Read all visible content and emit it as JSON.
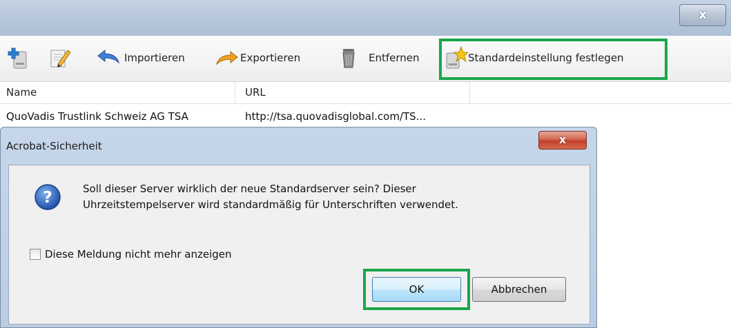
{
  "window": {
    "close_glyph": "x"
  },
  "toolbar": {
    "items": [
      {
        "label": "",
        "icon": "add-server-icon"
      },
      {
        "label": "",
        "icon": "edit-icon"
      },
      {
        "label": "Importieren",
        "icon": "import-arrow-icon"
      },
      {
        "label": "Exportieren",
        "icon": "export-arrow-icon"
      },
      {
        "label": "Entfernen",
        "icon": "trash-icon"
      },
      {
        "label": "Standardeinstellung festlegen",
        "icon": "set-default-star-icon"
      }
    ]
  },
  "list": {
    "columns": [
      "Name",
      "URL"
    ],
    "rows": [
      {
        "name": "QuoVadis Trustlink Schweiz AG TSA",
        "url": "http://tsa.quovadisglobal.com/TS..."
      }
    ]
  },
  "dialog": {
    "title": "Acrobat-Sicherheit",
    "close_glyph": "x",
    "message_line1": "Soll dieser Server wirklich der neue Standardserver sein? Dieser",
    "message_line2": "Uhrzeitstempelserver wird standardmäßig für Unterschriften verwendet.",
    "checkbox_label": "Diese Meldung nicht mehr anzeigen",
    "checkbox_checked": false,
    "ok_label": "OK",
    "cancel_label": "Abbrechen"
  },
  "colors": {
    "highlight": "#1aa64b",
    "close_button_red": "#c0402a"
  }
}
